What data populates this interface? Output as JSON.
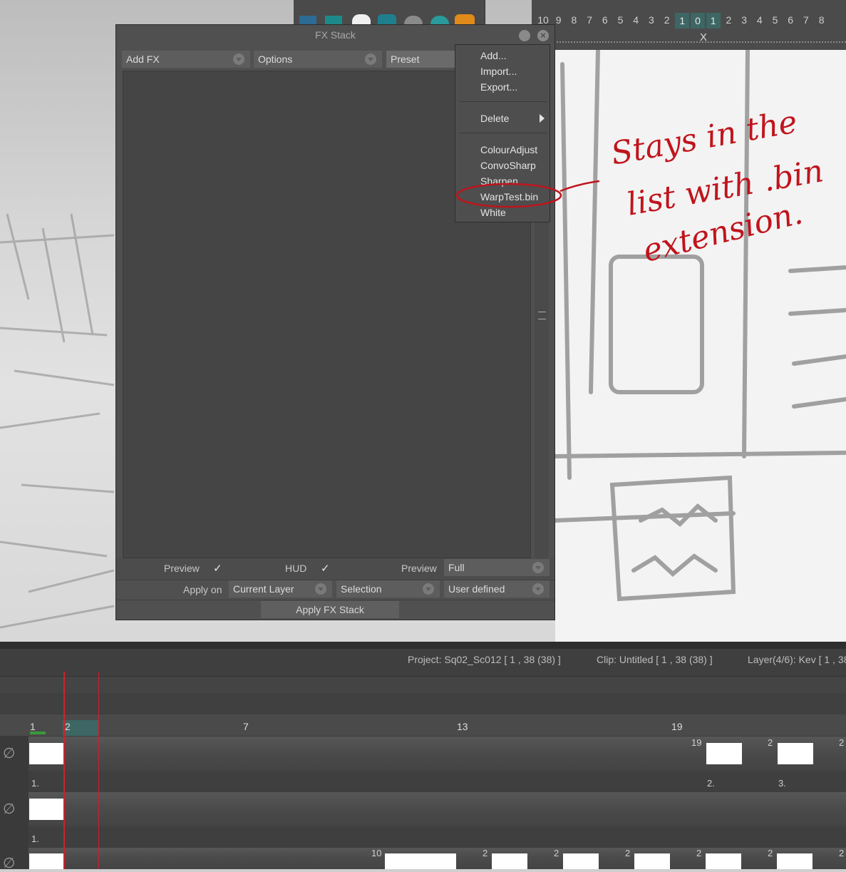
{
  "window": {
    "title": "FX Stack"
  },
  "toolbar": {
    "add_fx": "Add FX",
    "options": "Options",
    "preset": "Preset"
  },
  "preset_menu": {
    "add": "Add...",
    "import": "Import...",
    "export": "Export...",
    "delete": "Delete",
    "presets": [
      "ColourAdjust",
      "ConvoSharp",
      "Sharpen",
      "WarpTest.bin",
      "White"
    ]
  },
  "footer": {
    "preview_label": "Preview",
    "hud_label": "HUD",
    "preview2_label": "Preview",
    "preview_value": "Full",
    "apply_on_label": "Apply on",
    "apply_on_value": "Current Layer",
    "selection_value": "Selection",
    "user_defined_value": "User defined",
    "apply_button": "Apply FX Stack",
    "check": "✓"
  },
  "light_table": {
    "numbers": [
      "10",
      "9",
      "8",
      "7",
      "6",
      "5",
      "4",
      "3",
      "2",
      "1",
      "0",
      "1",
      "2",
      "3",
      "4",
      "5",
      "6",
      "7",
      "8"
    ],
    "marker": "X"
  },
  "annotation": {
    "line1": "Stays in the",
    "line2": "list with .bin",
    "line3": "extension."
  },
  "status": {
    "project": "Project: Sq02_Sc012 [ 1 , 38  (38) ]",
    "clip": "Clip: Untitled [ 1 , 38  (38) ]",
    "layer": "Layer(4/6): Kev [ 1 , 38"
  },
  "ruler": {
    "n1": "1",
    "n2": "2",
    "n7": "7",
    "n13": "13",
    "n19": "19"
  },
  "tracks": {
    "t1_start": "1.",
    "t1_n19": "19",
    "t1_n2a": "2",
    "t1_n2b": "2",
    "t1_lbl2": "2.",
    "t1_lbl3": "3.",
    "t2_start": "1.",
    "t3_n10": "10",
    "t3_n2": "2"
  }
}
